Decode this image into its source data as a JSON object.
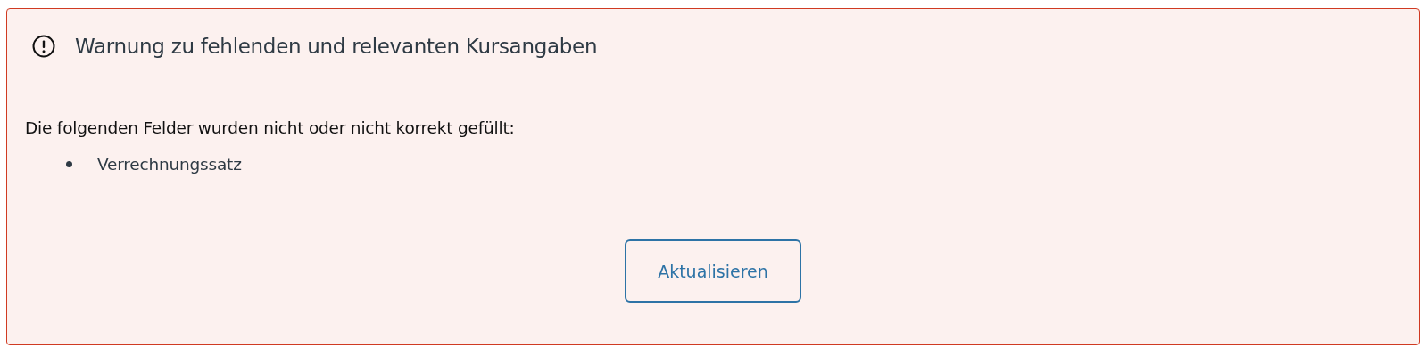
{
  "alert": {
    "title": "Warnung zu fehlenden und relevanten Kursangaben",
    "message": "Die folgenden Felder wurden nicht oder nicht korrekt gefüllt:",
    "items": [
      "Verrechnungssatz"
    ],
    "button": "Aktualisieren"
  }
}
